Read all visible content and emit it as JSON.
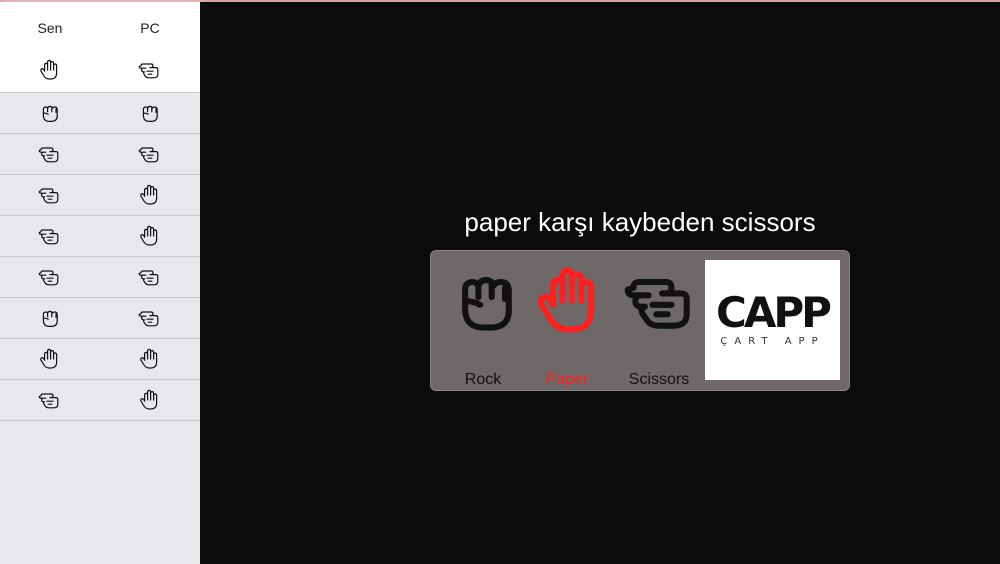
{
  "sidebar": {
    "headers": {
      "sen": "Sen",
      "pc": "PC"
    },
    "current": {
      "sen": "paper",
      "pc": "scissors"
    },
    "history": [
      {
        "sen": "rock",
        "pc": "rock"
      },
      {
        "sen": "scissors",
        "pc": "scissors"
      },
      {
        "sen": "scissors",
        "pc": "paper"
      },
      {
        "sen": "scissors",
        "pc": "paper"
      },
      {
        "sen": "scissors",
        "pc": "scissors"
      },
      {
        "sen": "rock",
        "pc": "scissors"
      },
      {
        "sen": "paper",
        "pc": "paper"
      },
      {
        "sen": "scissors",
        "pc": "paper"
      }
    ]
  },
  "main": {
    "result_text": "paper karşı kaybeden scissors",
    "choices": [
      {
        "key": "rock",
        "label": "Rock",
        "selected": false
      },
      {
        "key": "paper",
        "label": "Paper",
        "selected": true
      },
      {
        "key": "scissors",
        "label": "Scissors",
        "selected": false
      }
    ],
    "logo": {
      "main": "CAPP",
      "sub": "ÇART APP"
    }
  },
  "colors": {
    "selected": "#ff2020",
    "panel": "#6e6868",
    "background": "#0b0b0b"
  }
}
